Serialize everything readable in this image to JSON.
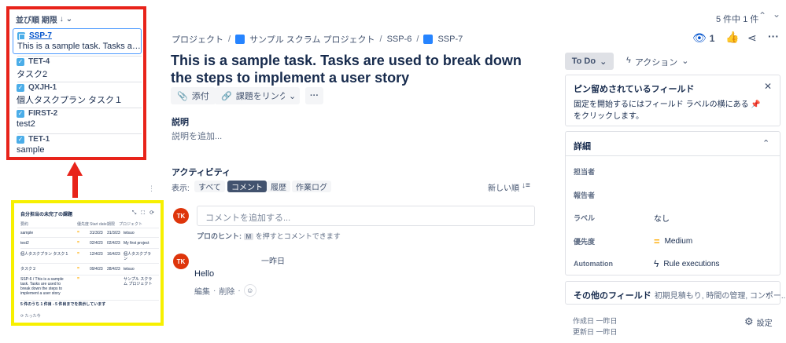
{
  "issue_list": {
    "sort_label": "並び順 期限",
    "items": [
      {
        "key": "SSP-7",
        "summary": "This is a sample task. Tasks are u...",
        "type": "subtask"
      },
      {
        "key": "TET-4",
        "summary": "タスク2",
        "type": "task"
      },
      {
        "key": "QXJH-1",
        "summary": "個人タスクプラン タスク１",
        "type": "task"
      },
      {
        "key": "FIRST-2",
        "summary": "test2",
        "type": "task"
      },
      {
        "key": "TET-1",
        "summary": "sample",
        "type": "task"
      }
    ]
  },
  "widget": {
    "title": "自分担当の未完了の課題",
    "headers": [
      "要約",
      "優先度",
      "Start date",
      "期限",
      "プロジェクト"
    ],
    "rows": [
      {
        "summary": "sample",
        "priority": "=",
        "start": "31/3/23",
        "due": "31/3/23",
        "project": "tetsuo"
      },
      {
        "summary": "test2",
        "priority": "=",
        "start": "02/4/23",
        "due": "02/4/23",
        "project": "My first project"
      },
      {
        "summary": "個人タスクプラン タスク１",
        "priority": "=",
        "start": "12/4/23",
        "due": "16/4/23",
        "project": "個人タスクプラン"
      },
      {
        "summary": "タスク２",
        "priority": "=",
        "start": "09/4/23",
        "due": "28/4/23",
        "project": "tetsuo"
      },
      {
        "summary": "SSP-6 / This is a sample task. Tasks are used to break down the steps to implement a user story",
        "priority": "=",
        "start": "",
        "due": "",
        "project": "サンプル スクラム プロジェクト"
      }
    ],
    "footer": "5 件のうち 1 件目 - 5 件目までを表示しています",
    "refresh": "たった今"
  },
  "header": {
    "pager": "5 件中 1 件",
    "watch_count": "1"
  },
  "breadcrumb": {
    "root": "プロジェクト",
    "project": "サンプル スクラム プロジェクト",
    "parent": "SSP-6",
    "current": "SSP-7"
  },
  "issue": {
    "title": "This is a sample task. Tasks are used to break down the steps to implement a user story",
    "attach_label": "添付",
    "link_label": "課題をリンク",
    "description_heading": "説明",
    "description_placeholder": "説明を追加..."
  },
  "activity": {
    "heading": "アクティビティ",
    "show_label": "表示:",
    "filters": [
      "すべて",
      "コメント",
      "履歴",
      "作業ログ"
    ],
    "sort_label": "新しい順",
    "comment_placeholder": "コメントを追加する...",
    "tip_prefix": "プロのヒント:",
    "tip_key": "M",
    "tip_suffix": "を押すとコメントできます",
    "comments": [
      {
        "initials": "TK",
        "time": "一昨日",
        "body": "Hello",
        "actions": [
          "編集",
          "削除"
        ]
      }
    ],
    "user_initials": "TK"
  },
  "sidebar": {
    "status": "To Do",
    "actions_label": "アクション",
    "pinned_title": "ピン留めされているフィールド",
    "pinned_body": "固定を開始するにはフィールド ラベルの横にある 📌 をクリックします。",
    "details_title": "詳細",
    "fields": [
      {
        "label": "担当者",
        "value": ""
      },
      {
        "label": "報告者",
        "value": ""
      },
      {
        "label": "ラベル",
        "value": "なし"
      },
      {
        "label": "優先度",
        "value": "Medium"
      },
      {
        "label": "Automation",
        "value": "Rule executions"
      }
    ],
    "other_fields_title": "その他のフィールド",
    "other_fields_hint": "初期見積もり, 時間の管理, コンポー...",
    "created": "作成日 一昨日",
    "updated": "更新日 一昨日",
    "settings_label": "設定"
  },
  "colors": {
    "annotation_red": "#e8231a",
    "annotation_yellow": "#f7f000",
    "priority_medium": "#ffab00",
    "avatar": "#de350b"
  }
}
